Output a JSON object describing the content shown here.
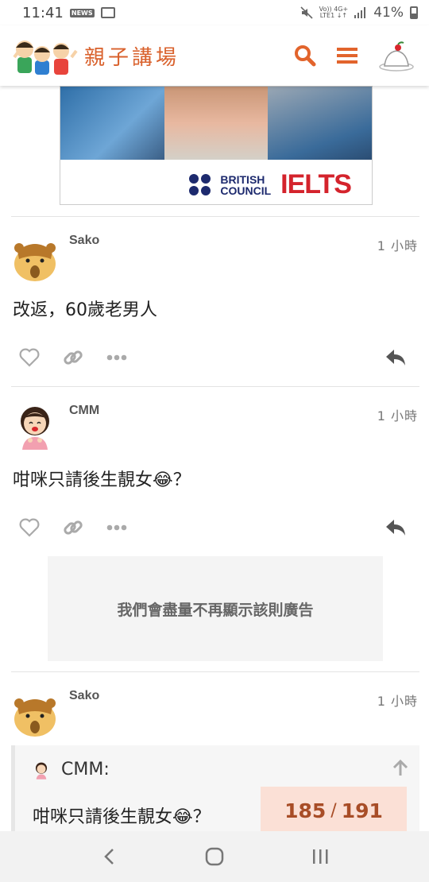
{
  "status_bar": {
    "time": "11:41",
    "news_label": "NEWS",
    "network_top": "Vo)) 4G+",
    "network_bottom": "LTE1 ↓↑",
    "battery": "41%"
  },
  "header": {
    "site_name": "親子講場",
    "icons": [
      "search-icon",
      "menu-icon",
      "pudding-avatar"
    ],
    "accent_color": "#e2642c"
  },
  "ad_banner": {
    "brand1_line1": "BRITISH",
    "brand1_line2": "COUNCIL",
    "brand2": "IELTS"
  },
  "posts": [
    {
      "username": "Sako",
      "time": "1 小時",
      "body": "改返，60歲老男人",
      "avatar": "hamster"
    },
    {
      "username": "CMM",
      "time": "1 小時",
      "body": "咁咪只請後生靚女😂？",
      "avatar": "girl"
    },
    {
      "username": "Sako",
      "time": "1 小時",
      "avatar": "hamster",
      "quote": {
        "username": "CMM:",
        "body": "咁咪只請後生靚女😂？"
      }
    }
  ],
  "ad_hidden_text": "我們會盡量不再顯示該則廣告",
  "progress": {
    "current": "185",
    "separator": "/",
    "total": "191"
  },
  "nav_bar": {
    "icons": [
      "back-icon",
      "home-icon",
      "recents-icon"
    ]
  }
}
